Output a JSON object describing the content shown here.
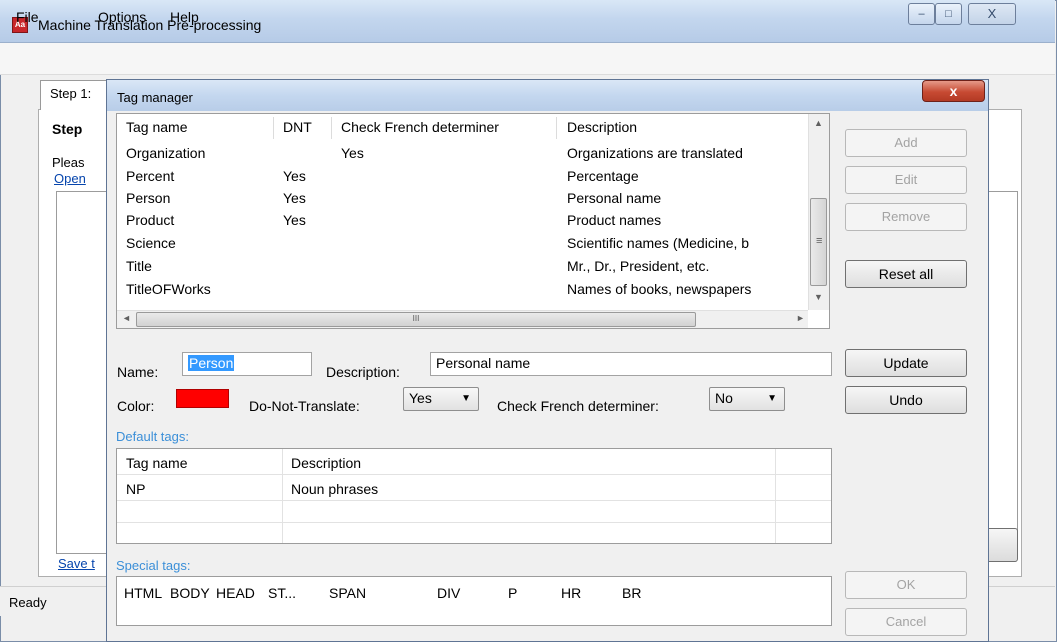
{
  "main_window": {
    "title": "Machine Translation Pre-processing",
    "icon_text": "Aa",
    "caption_buttons": {
      "minimize": "–",
      "maximize": "□",
      "close": "X"
    },
    "menu": [
      "File",
      "Options",
      "Help"
    ],
    "tab_label": "Step 1:",
    "step_heading": "Step",
    "instruction_text": "Pleas",
    "open_link": "Open",
    "save_link": "Save t",
    "status": "Ready"
  },
  "dialog": {
    "title": "Tag manager",
    "close_label": "x",
    "tag_table": {
      "columns": [
        "Tag name",
        "DNT",
        "Check French determiner",
        "Description"
      ],
      "rows": [
        {
          "name": "Organization",
          "dnt": "",
          "check_french": "Yes",
          "description": "Organizations are translated"
        },
        {
          "name": "Percent",
          "dnt": "Yes",
          "check_french": "",
          "description": "Percentage"
        },
        {
          "name": "Person",
          "dnt": "Yes",
          "check_french": "",
          "description": "Personal name"
        },
        {
          "name": "Product",
          "dnt": "Yes",
          "check_french": "",
          "description": "Product names"
        },
        {
          "name": "Science",
          "dnt": "",
          "check_french": "",
          "description": "Scientific names (Medicine, b"
        },
        {
          "name": "Title",
          "dnt": "",
          "check_french": "",
          "description": "Mr., Dr., President, etc."
        },
        {
          "name": "TitleOFWorks",
          "dnt": "",
          "check_french": "",
          "description": "Names of books, newspapers"
        }
      ],
      "scroll_glyphs": {
        "up": "▲",
        "down": "▼",
        "left": "◄",
        "right": "►",
        "thumb_grip": "III",
        "vthumb_grip": "≡"
      }
    },
    "side_buttons": {
      "add": "Add",
      "edit": "Edit",
      "remove": "Remove",
      "reset_all": "Reset all",
      "update": "Update",
      "undo": "Undo",
      "ok": "OK",
      "cancel": "Cancel"
    },
    "form": {
      "name_label": "Name:",
      "name_value": "Person",
      "description_label": "Description:",
      "description_value": "Personal name",
      "color_label": "Color:",
      "color_value": "#ff0000",
      "dnt_label": "Do-Not-Translate:",
      "dnt_value": "Yes",
      "french_label": "Check French determiner:",
      "french_value": "No"
    },
    "default_tags": {
      "label": "Default tags:",
      "columns": [
        "Tag name",
        "Description"
      ],
      "rows": [
        {
          "name": "NP",
          "description": "Noun phrases"
        }
      ]
    },
    "special_tags": {
      "label": "Special tags:",
      "items": [
        "HTML",
        "BODY",
        "HEAD",
        "ST...",
        "SPAN",
        "DIV",
        "P",
        "HR",
        "BR"
      ]
    }
  }
}
